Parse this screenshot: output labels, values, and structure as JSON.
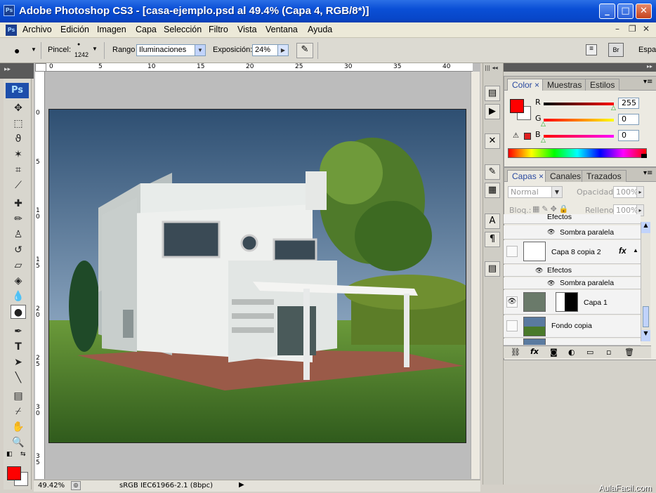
{
  "window": {
    "title": "Adobe Photoshop CS3 - [casa-ejemplo.psd al 49.4% (Capa 4, RGB/8*)]",
    "app_icon": "Ps"
  },
  "menu": [
    "Archivo",
    "Edición",
    "Imagen",
    "Capa",
    "Selección",
    "Filtro",
    "Vista",
    "Ventana",
    "Ayuda"
  ],
  "options": {
    "brush_label": "Pincel:",
    "brush_size": "1242",
    "range_label": "Rango",
    "range_value": "Iluminaciones",
    "exposure_label": "Exposición:",
    "exposure_value": "24%",
    "workspace": "Espa"
  },
  "ruler_h": [
    "0",
    "5",
    "10",
    "15",
    "20",
    "25",
    "30",
    "35",
    "40"
  ],
  "ruler_v": [
    "0",
    "5",
    "1 0",
    "1 5",
    "2 0",
    "2 5",
    "3 0",
    "3 5"
  ],
  "status": {
    "zoom": "49.42%",
    "profile": "sRGB IEC61966-2.1 (8bpc)"
  },
  "color_panel": {
    "tabs": [
      "Color",
      "Muestras",
      "Estilos"
    ],
    "r_label": "R",
    "g_label": "G",
    "b_label": "B",
    "r_value": "255",
    "g_value": "0",
    "b_value": "0",
    "foreground_color": "#ff0000"
  },
  "layers_panel": {
    "tabs": [
      "Capas",
      "Canales",
      "Trazados"
    ],
    "blend_mode": "Normal",
    "opacity_label": "Opacidad:",
    "opacity_value": "100%",
    "lock_label": "Bloq.:",
    "fill_label": "Relleno:",
    "fill_value": "100%",
    "rows": [
      {
        "type": "effects",
        "label": "Efectos"
      },
      {
        "type": "effect",
        "label": "Sombra paralela"
      },
      {
        "type": "layer",
        "label": "Capa 8 copia 2",
        "fx": "fx"
      },
      {
        "type": "effects",
        "label": "Efectos"
      },
      {
        "type": "effect",
        "label": "Sombra paralela"
      },
      {
        "type": "layer",
        "label": "Capa 1",
        "visible": true
      },
      {
        "type": "layer",
        "label": "Fondo copia"
      }
    ]
  },
  "watermark": "AulaFacil.com",
  "toolbox_badge": "Ps"
}
